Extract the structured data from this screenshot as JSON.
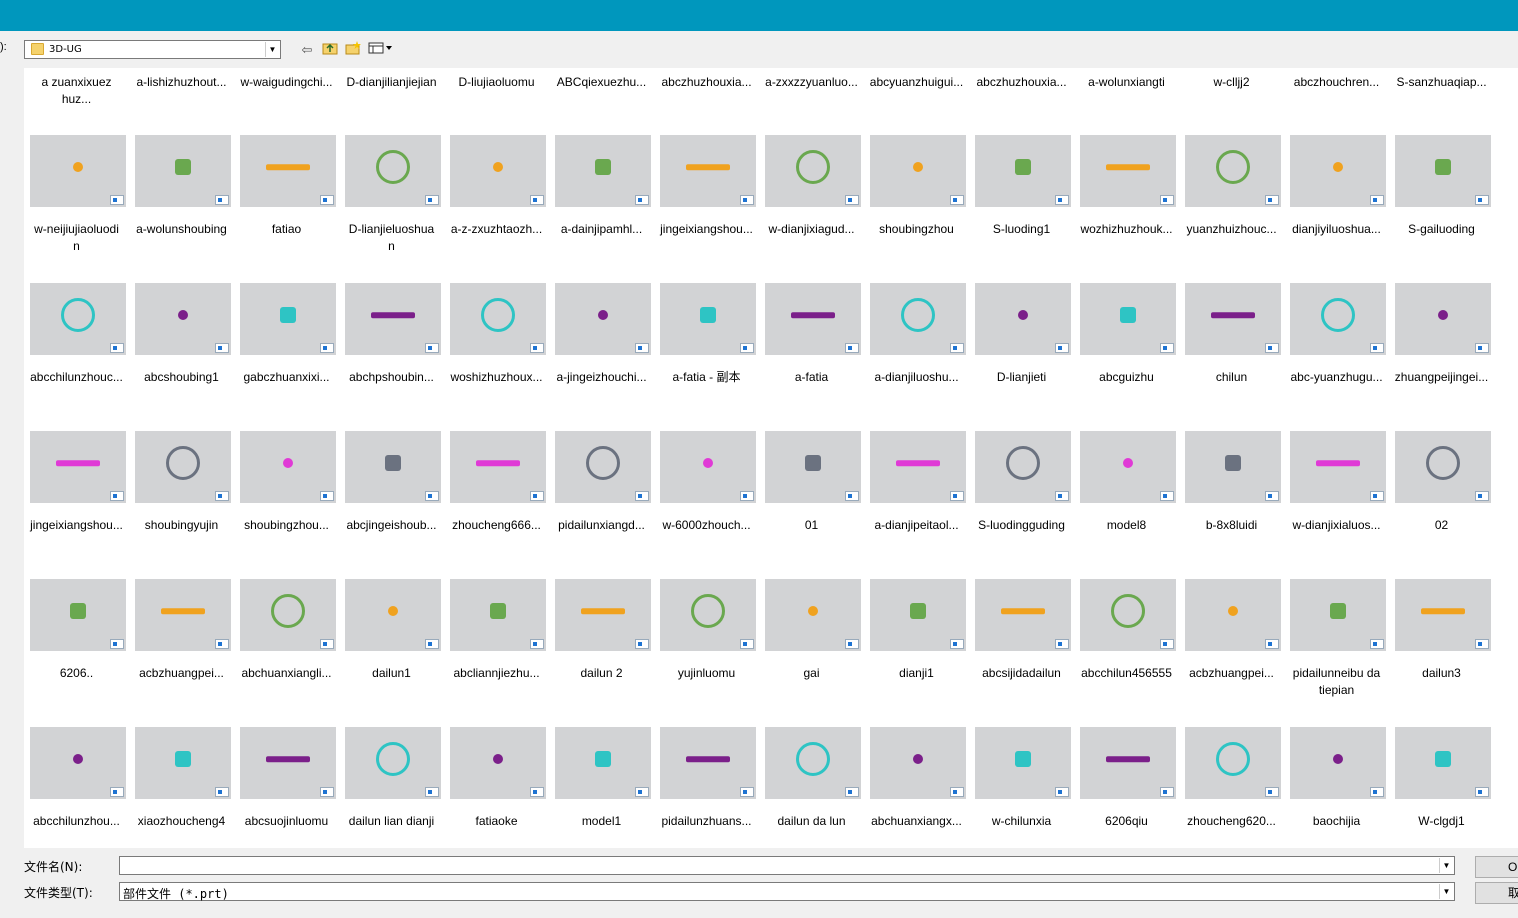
{
  "window": {
    "title_bar_color": "#0097bd"
  },
  "toolbar": {
    "look_in_label": "):",
    "look_in_value": "3D-UG",
    "icons": [
      "back-icon",
      "up-folder-icon",
      "new-folder-icon",
      "view-menu-icon"
    ]
  },
  "first_row": [
    "a zuanxixuezhuz...",
    "a-lishizhuzhout...",
    "w-waigudingchi...",
    "D-dianjilianjiejian",
    "D-liujiaoluomu",
    "ABCqiexuezhu...",
    "abczhuzhouxia...",
    "a-zxxzzyuanluo...",
    "abcyuanzhuigui...",
    "abczhuzhouxia...",
    "a-wolunxiangti",
    "w-clljj2",
    "abczhouchren...",
    "S-sanzhuaqiap..."
  ],
  "rows": [
    [
      "w-neijiujiaoluodin",
      "a-wolunshoubing",
      "fatiao",
      "D-lianjieluoshuan",
      "a-z-zxuzhtaozh...",
      "a-dainjipamhl...",
      "jingeixiangshou...",
      "w-dianjixiagud...",
      "shoubingzhou",
      "S-luoding1",
      "wozhizhuzhouk...",
      "yuanzhuizhouc...",
      "dianjiyiluoshua...",
      "S-gailuoding"
    ],
    [
      "abcchilunzhouc...",
      "abcshoubing1",
      "gabczhuanxixi...",
      "abchpshoubin...",
      "woshizhuzhoux...",
      "a-jingeizhouchi...",
      "a-fatia - 副本",
      "a-fatia",
      "a-dianjiluoshu...",
      "D-lianjieti",
      "abcguizhu",
      "chilun",
      "abc-yuanzhugu...",
      "zhuangpeijingei..."
    ],
    [
      "jingeixiangshou...",
      "shoubingyujin",
      "shoubingzhou...",
      "abcjingeishoub...",
      "zhoucheng666...",
      "pidailunxiangd...",
      "w-6000zhouch...",
      "01",
      "a-dianjipeitaol...",
      "S-luodingguding",
      "model8",
      "b-8x8luidi",
      "w-dianjixialuos...",
      "02"
    ],
    [
      "6206..",
      "acbzhuangpei...",
      "abchuanxiangli...",
      "dailun1",
      "abcliannjiezhu...",
      "dailun    2",
      "yujinluomu",
      "gai",
      "dianji1",
      "abcsijidadailun",
      "abcchilun456555",
      "acbzhuangpei...",
      "pidailunneibu datiepian",
      "dailun3"
    ],
    [
      "abcchilunzhou...",
      "xiaozhoucheng4",
      "abcsuojinluomu",
      "dailun   lian dianji",
      "fatiaoke",
      "model1",
      "pidailunzhuans...",
      "dailun     da   lun",
      "abchuanxiangx...",
      "w-chilunxia",
      "6206qiu",
      "zhoucheng620...",
      "baochijia",
      "W-clgdj1"
    ]
  ],
  "colors": {
    "thumb_bg": "#d2d3d5",
    "part_orange": "#f0a21f",
    "part_gray": "#6b7280",
    "part_purple": "#7b1f8a",
    "part_magenta": "#e03ad6",
    "part_green": "#6aa84f",
    "part_teal": "#2ec4c4"
  },
  "footer": {
    "filename_label": "文件名(N):",
    "filename_value": "",
    "filetype_label": "文件类型(T):",
    "filetype_value": "部件文件 (*.prt)",
    "ok_label": "O",
    "cancel_label": "取"
  }
}
